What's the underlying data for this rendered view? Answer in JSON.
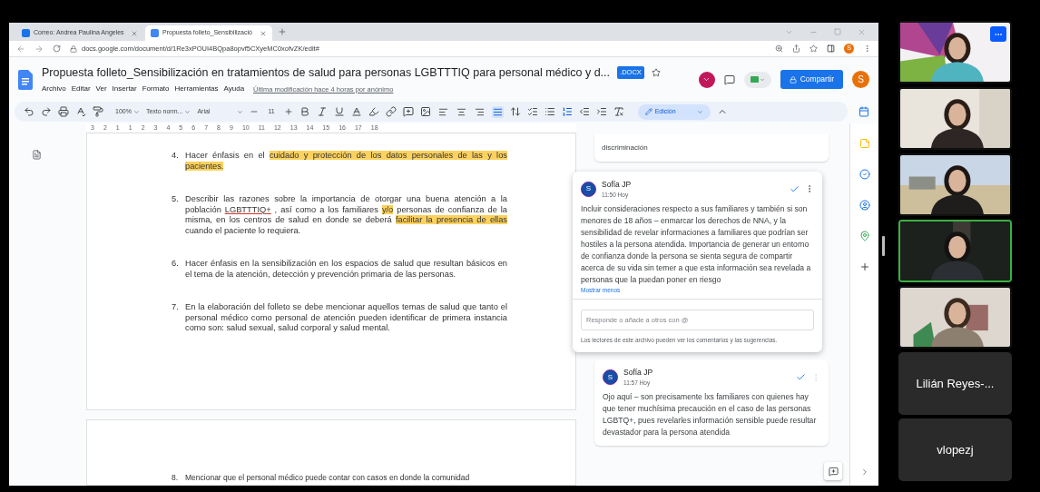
{
  "browser": {
    "tabs": [
      {
        "title": "Correo: Andrea Paulina Angeles",
        "selected": false
      },
      {
        "title": "Propuesta folleto_Sensibilizació",
        "selected": true
      }
    ],
    "url": "docs.google.com/document/d/1Re3xPOUI4BQpa8opvf5CXyeMC0xofvZK/edit#",
    "profile": "S"
  },
  "document": {
    "title": "Propuesta folleto_Sensibilización en tratamientos de salud para personas LGBTTTIQ para personal médico y d...",
    "badge": ".DOCX",
    "menus": [
      "Archivo",
      "Editar",
      "Ver",
      "Insertar",
      "Formato",
      "Herramientas",
      "Ayuda"
    ],
    "last_edit": "Última modificación hace 4 horas por anónimo",
    "share": "Compartir",
    "avatar": "S"
  },
  "toolbar": {
    "zoom": "100%",
    "style": "Texto norm...",
    "font": "Arial",
    "size": "11",
    "mode": "Edición",
    "align_buttons": [
      {
        "kind": "left",
        "selected": false
      },
      {
        "kind": "center",
        "selected": false
      },
      {
        "kind": "right",
        "selected": false
      },
      {
        "kind": "justify",
        "selected": true
      }
    ]
  },
  "ruler": [
    "3",
    "2",
    "1",
    "1",
    "2",
    "3",
    "4",
    "5",
    "6",
    "7",
    "8",
    "9",
    "10",
    "11",
    "12",
    "13",
    "14",
    "15",
    "16",
    "17",
    "18"
  ],
  "items": [
    {
      "number": "4.",
      "segments": [
        {
          "text": "Hacer énfasis en el ",
          "kind": "plain"
        },
        {
          "text": "cuidado y protección de los datos personales de las y los pacientes.",
          "kind": "highlight"
        }
      ]
    },
    {
      "number": "5.",
      "segments": [
        {
          "text": "Describir las razones sobre la importancia de otorgar una buena atención a la población ",
          "kind": "plain"
        },
        {
          "text": "LGBTTTIQ+",
          "kind": "misspelled"
        },
        {
          "text": " , así como a los familiares ",
          "kind": "plain"
        },
        {
          "text": "y/o",
          "kind": "highlight"
        },
        {
          "text": " personas de confianza de la misma, en los centros de salud en donde se deberá ",
          "kind": "plain"
        },
        {
          "text": "facilitar la presencia de ellas",
          "kind": "highlight"
        },
        {
          "text": " cuando el paciente lo requiera.",
          "kind": "plain"
        }
      ]
    },
    {
      "number": "6.",
      "segments": [
        {
          "text": "Hacer énfasis en la sensibilización en los espacios de salud que resultan básicos en el tema de la atención, detección y prevención primaria de las personas.",
          "kind": "plain"
        }
      ]
    },
    {
      "number": "7.",
      "segments": [
        {
          "text": "En la elaboración del folleto se debe mencionar aquellos temas de salud que tanto el personal médico como personal de atención pueden identificar de primera instancia como son: salud sexual, salud corporal y salud mental.",
          "kind": "plain"
        }
      ]
    }
  ],
  "next_page_item": {
    "number": "8.",
    "text": "Mencionar que el personal médico puede contar con casos en donde la comunidad"
  },
  "comments": {
    "partial": "discriminación",
    "threads": [
      {
        "author": "Sofía JP",
        "initial": "S",
        "time": "11:50 Hoy",
        "text": "Incluir consideraciones respecto a sus familiares y también si son menores de 18 años – enmarcar los derechos de NNA, y la sensibilidad de revelar informaciones a familiares que podrían ser hostiles a la persona atendida. Importancia de generar un entorno de confianza donde la persona se sienta segura de compartir acerca de su vida sin temer a que esta información sea revelada a personas que la puedan poner en riesgo",
        "toggle": "Mostrar menos",
        "reply_placeholder": "Responde o añade a otros con @",
        "note": "Los lectores de este archivo pueden ver los comentarios y las sugerencias.",
        "active": true
      },
      {
        "author": "Sofía JP",
        "initial": "S",
        "time": "11:57 Hoy",
        "text": "Ojo aquí – son precisamente lxs familiares con quienes hay que tener muchísima precaución en el caso de las personas LGBTQ+, pues revelarles información sensible puede resultar devastador para la persona atendida",
        "active": false
      }
    ]
  },
  "participants": [
    {
      "kind": "video",
      "speaking": false,
      "menu_button": true
    },
    {
      "kind": "video",
      "speaking": false,
      "menu_button": false
    },
    {
      "kind": "video",
      "speaking": false,
      "menu_button": false
    },
    {
      "kind": "video",
      "speaking": true,
      "menu_button": false
    },
    {
      "kind": "video",
      "speaking": false,
      "menu_button": false
    },
    {
      "kind": "name",
      "name": "Lilián Reyes-..."
    },
    {
      "kind": "name",
      "name": "vlopezj"
    }
  ]
}
